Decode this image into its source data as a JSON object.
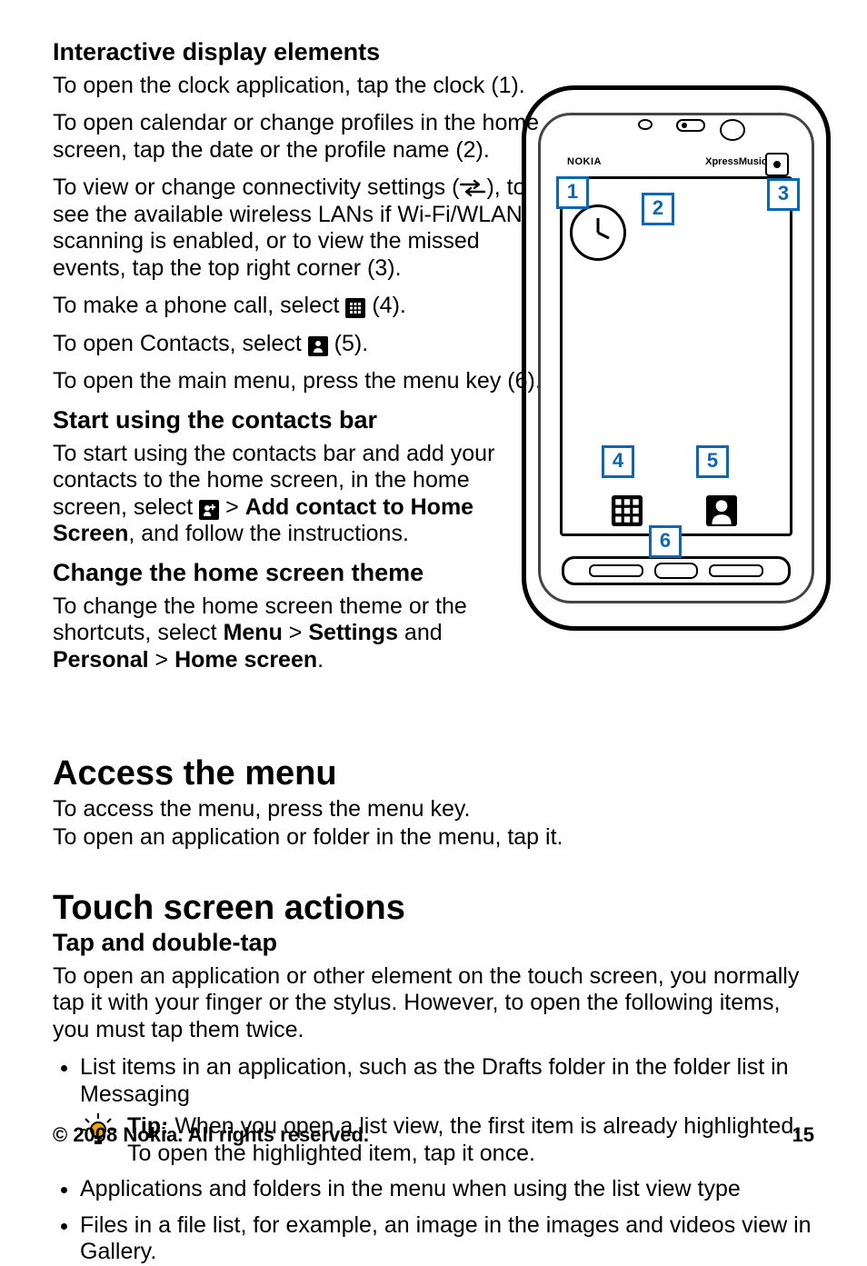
{
  "sections": {
    "interactive": {
      "heading": "Interactive display elements",
      "p1": "To open the clock application, tap the clock (1).",
      "p2": "To open calendar or change profiles in the home screen, tap the date or the profile name (2).",
      "p3a": "To view or change connectivity settings (",
      "p3b": "), to see the available wireless LANs if Wi-Fi/WLAN scanning is enabled, or to view the missed events, tap the top right corner (3).",
      "p4a": "To make a phone call, select ",
      "p4b": " (4).",
      "p5a": "To open Contacts, select ",
      "p5b": " (5).",
      "p6": "To open the main menu, press the menu key (6)."
    },
    "contacts_bar": {
      "heading": "Start using the contacts bar",
      "p1a": "To start using the contacts bar and add your contacts to the home screen, in the home screen, select ",
      "gt1": " > ",
      "bold_add": "Add contact to Home Screen",
      "p1b": ", and follow the instructions."
    },
    "change_theme": {
      "heading": "Change the home screen theme",
      "p1a": "To change the home screen theme or the shortcuts, select ",
      "menu": "Menu",
      "gt1": " > ",
      "settings": "Settings",
      "and": " and ",
      "personal": "Personal",
      "gt2": " > ",
      "home": "Home screen",
      "end": "."
    },
    "access_menu": {
      "heading": "Access the menu",
      "p1": "To access the menu, press the menu key.",
      "p2": "To open an application or folder in the menu, tap it."
    },
    "touch": {
      "heading": "Touch screen actions",
      "sub1": "Tap and double-tap",
      "p1": "To open an application or other element on the touch screen, you normally tap it with your finger or the stylus. However, to open the following items, you must tap them twice.",
      "li1": "List items in an application, such as the Drafts folder in the folder list in Messaging",
      "tip_label": "Tip:",
      "tip_body": " When you open a list view, the first item is already highlighted. To open the highlighted item, tap it once.",
      "li2": "Applications and folders in the menu when using the list view type",
      "li3": "Files in a file list, for example, an image in the images and videos view in Gallery."
    }
  },
  "figure": {
    "brand": "NOKIA",
    "brand2": "XpressMusic",
    "labels": {
      "l1": "1",
      "l2": "2",
      "l3": "3",
      "l4": "4",
      "l5": "5",
      "l6": "6"
    }
  },
  "footer": {
    "copyright": "© 2008 Nokia. All rights reserved.",
    "page": "15"
  }
}
